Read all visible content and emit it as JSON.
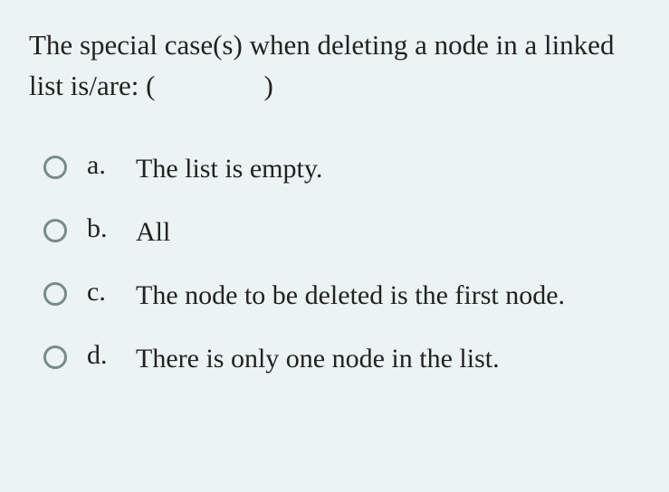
{
  "question": {
    "text_before": "The special case(s) when deleting a node in a linked list is/are: (",
    "text_after": ")"
  },
  "options": [
    {
      "label": "a.",
      "text": "The list is empty."
    },
    {
      "label": "b.",
      "text": "All"
    },
    {
      "label": "c.",
      "text": "The node to be deleted is the first node."
    },
    {
      "label": "d.",
      "text": "There is only one node in the list."
    }
  ]
}
